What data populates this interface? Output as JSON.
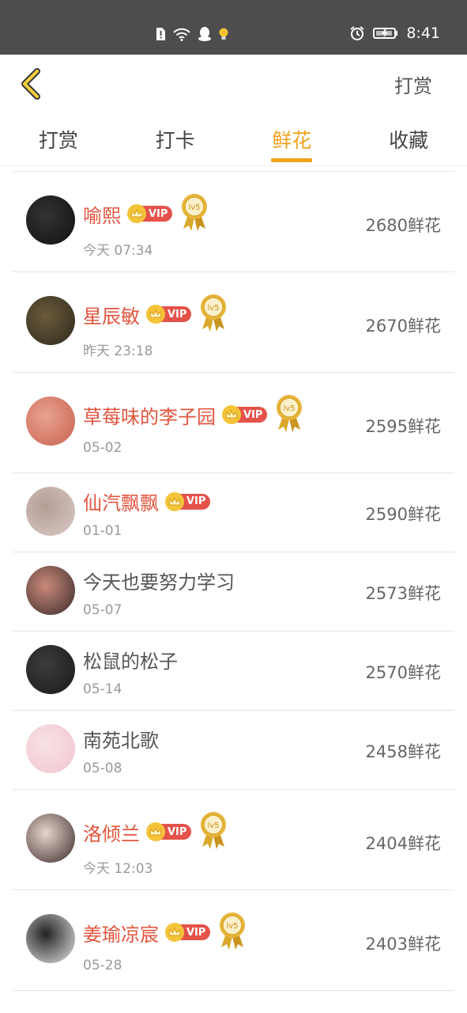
{
  "status_bar": {
    "time": "8:41"
  },
  "header": {
    "action_label": "打赏"
  },
  "tabs": [
    {
      "label": "打赏",
      "active": false
    },
    {
      "label": "打卡",
      "active": false
    },
    {
      "label": "鲜花",
      "active": true
    },
    {
      "label": "收藏",
      "active": false
    }
  ],
  "vip_label": "VIP",
  "medal_label": "lv5",
  "rows": [
    {
      "name": "喻熙",
      "vip": true,
      "medal": true,
      "time": "今天 07:34",
      "count": "2680鲜花",
      "avatar_colors": [
        "#111111",
        "#333333"
      ]
    },
    {
      "name": "星辰敏",
      "vip": true,
      "medal": true,
      "time": "昨天 23:18",
      "count": "2670鲜花",
      "avatar_colors": [
        "#2e2a1e",
        "#6b5a3a"
      ]
    },
    {
      "name": "草莓味的李子园",
      "vip": true,
      "medal": true,
      "time": "05-02",
      "count": "2595鲜花",
      "avatar_colors": [
        "#c9604f",
        "#e8a490"
      ]
    },
    {
      "name": "仙汽飘飘",
      "vip": true,
      "medal": false,
      "time": "01-01",
      "count": "2590鲜花",
      "avatar_colors": [
        "#d9c9c4",
        "#b39e95"
      ]
    },
    {
      "name": "今天也要努力学习",
      "vip": false,
      "medal": false,
      "time": "05-07",
      "count": "2573鲜花",
      "avatar_colors": [
        "#3a2a2a",
        "#c98a7a"
      ]
    },
    {
      "name": "松鼠的松子",
      "vip": false,
      "medal": false,
      "time": "05-14",
      "count": "2570鲜花",
      "avatar_colors": [
        "#1a1a1a",
        "#3c3c3c"
      ]
    },
    {
      "name": "南苑北歌",
      "vip": false,
      "medal": false,
      "time": "05-08",
      "count": "2458鲜花",
      "avatar_colors": [
        "#f1c6cf",
        "#f7e1e4"
      ]
    },
    {
      "name": "洛倾兰",
      "vip": true,
      "medal": true,
      "time": "今天 12:03",
      "count": "2404鲜花",
      "avatar_colors": [
        "#3a2a2a",
        "#e8d6cc"
      ]
    },
    {
      "name": "姜瑜凉宸",
      "vip": true,
      "medal": true,
      "time": "05-28",
      "count": "2403鲜花",
      "avatar_colors": [
        "#e6e6e6",
        "#222222"
      ]
    }
  ]
}
